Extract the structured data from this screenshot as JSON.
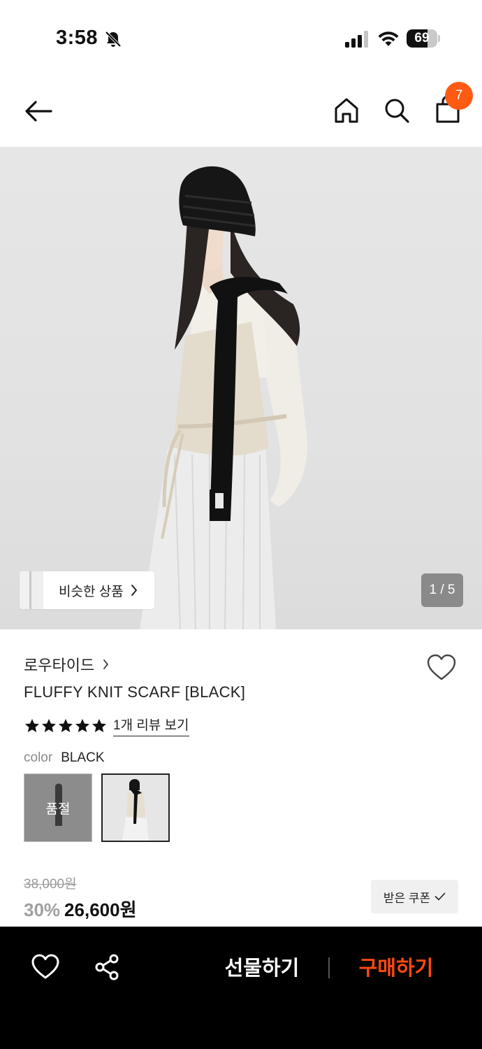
{
  "status_bar": {
    "time": "3:58",
    "battery": "69",
    "battery_level": 0.69,
    "icons": [
      "bell-off-icon",
      "cellular-signal-icon",
      "wifi-icon",
      "battery-icon"
    ]
  },
  "header": {
    "icons": [
      "arrow-left-icon",
      "home-icon",
      "search-icon",
      "shopping-bag-icon"
    ],
    "cart_count": "7"
  },
  "hero": {
    "similar_label": "비슷한 상품",
    "page_indicator": "1 / 5"
  },
  "product": {
    "brand": "로우타이드",
    "title": "FLUFFY KNIT SCARF [BLACK]",
    "rating_stars": 5,
    "review_link": "1개 리뷰 보기",
    "color_key": "color",
    "color_value": "BLACK",
    "swatches": [
      {
        "label": "품절"
      },
      {
        "label": ""
      }
    ]
  },
  "price": {
    "original": "38,000원",
    "discount": "30%",
    "final": "26,600원",
    "coupon_label": "받은 쿠폰"
  },
  "bottom_bar": {
    "gift_label": "선물하기",
    "buy_label": "구매하기",
    "accent_color": "#ff4a10"
  },
  "colors": {
    "badge": "#ff5a14",
    "bottom_bar_bg": "#000000"
  }
}
